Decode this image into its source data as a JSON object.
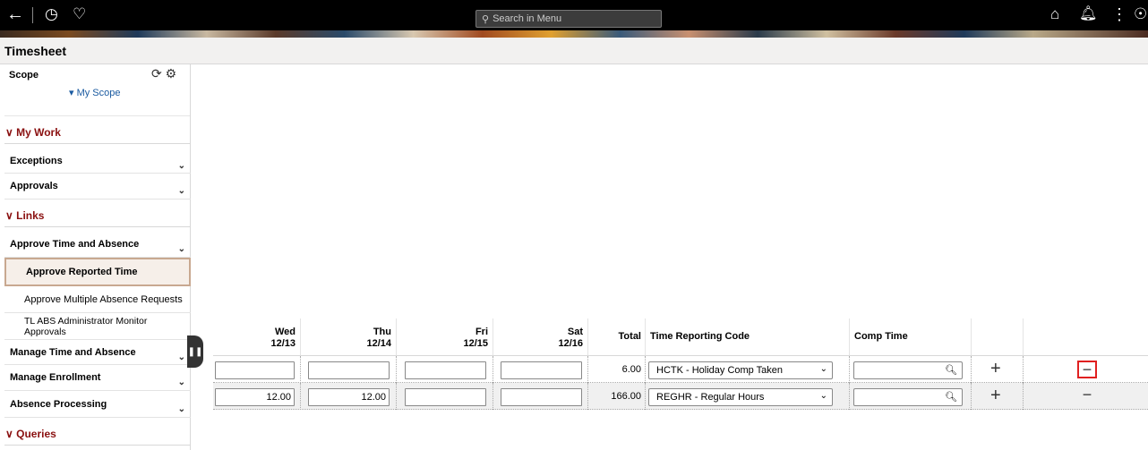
{
  "topbar": {
    "search_placeholder": "Search in Menu",
    "icons": [
      "back-arrow-icon",
      "recent-clock-icon",
      "favorites-heart-icon",
      "home-icon",
      "notification-bell-icon",
      "actions-menu-icon",
      "navbar-icon"
    ]
  },
  "page": {
    "title": "Timesheet"
  },
  "sidebar": {
    "scope_label": "Scope",
    "my_scope_label": "▾ My Scope",
    "sections": {
      "my_work": "∨ My Work",
      "links": "∨ Links",
      "queries": "∨ Queries"
    },
    "items": {
      "exceptions": "Exceptions",
      "approvals": "Approvals",
      "approve_time_absence": "Approve Time and Absence",
      "approve_reported_time": "Approve Reported Time",
      "approve_multiple_absence": "Approve Multiple Absence Requests",
      "tl_abs_monitor": "TL ABS Administrator Monitor Approvals",
      "manage_time_absence": "Manage Time and Absence",
      "manage_enrollment": "Manage Enrollment",
      "absence_processing": "Absence Processing"
    }
  },
  "grid": {
    "headers": {
      "wed_day": "Wed",
      "wed_date": "12/13",
      "thu_day": "Thu",
      "thu_date": "12/14",
      "fri_day": "Fri",
      "fri_date": "12/15",
      "sat_day": "Sat",
      "sat_date": "12/16",
      "total": "Total",
      "trc": "Time Reporting Code",
      "comp_time": "Comp Time"
    },
    "rows": [
      {
        "wed": "",
        "thu": "",
        "fri": "",
        "sat": "",
        "total": "6.00",
        "trc": "HCTK - Holiday Comp Taken",
        "comp_time": ""
      },
      {
        "wed": "12.00",
        "thu": "12.00",
        "fri": "",
        "sat": "",
        "total": "166.00",
        "trc": "REGHR - Regular Hours",
        "comp_time": ""
      }
    ],
    "add_symbol": "+",
    "delete_symbol": "−"
  },
  "colors": {
    "section_header": "#8a1010",
    "link": "#1a5aa0",
    "highlight_border": "#e02020"
  }
}
